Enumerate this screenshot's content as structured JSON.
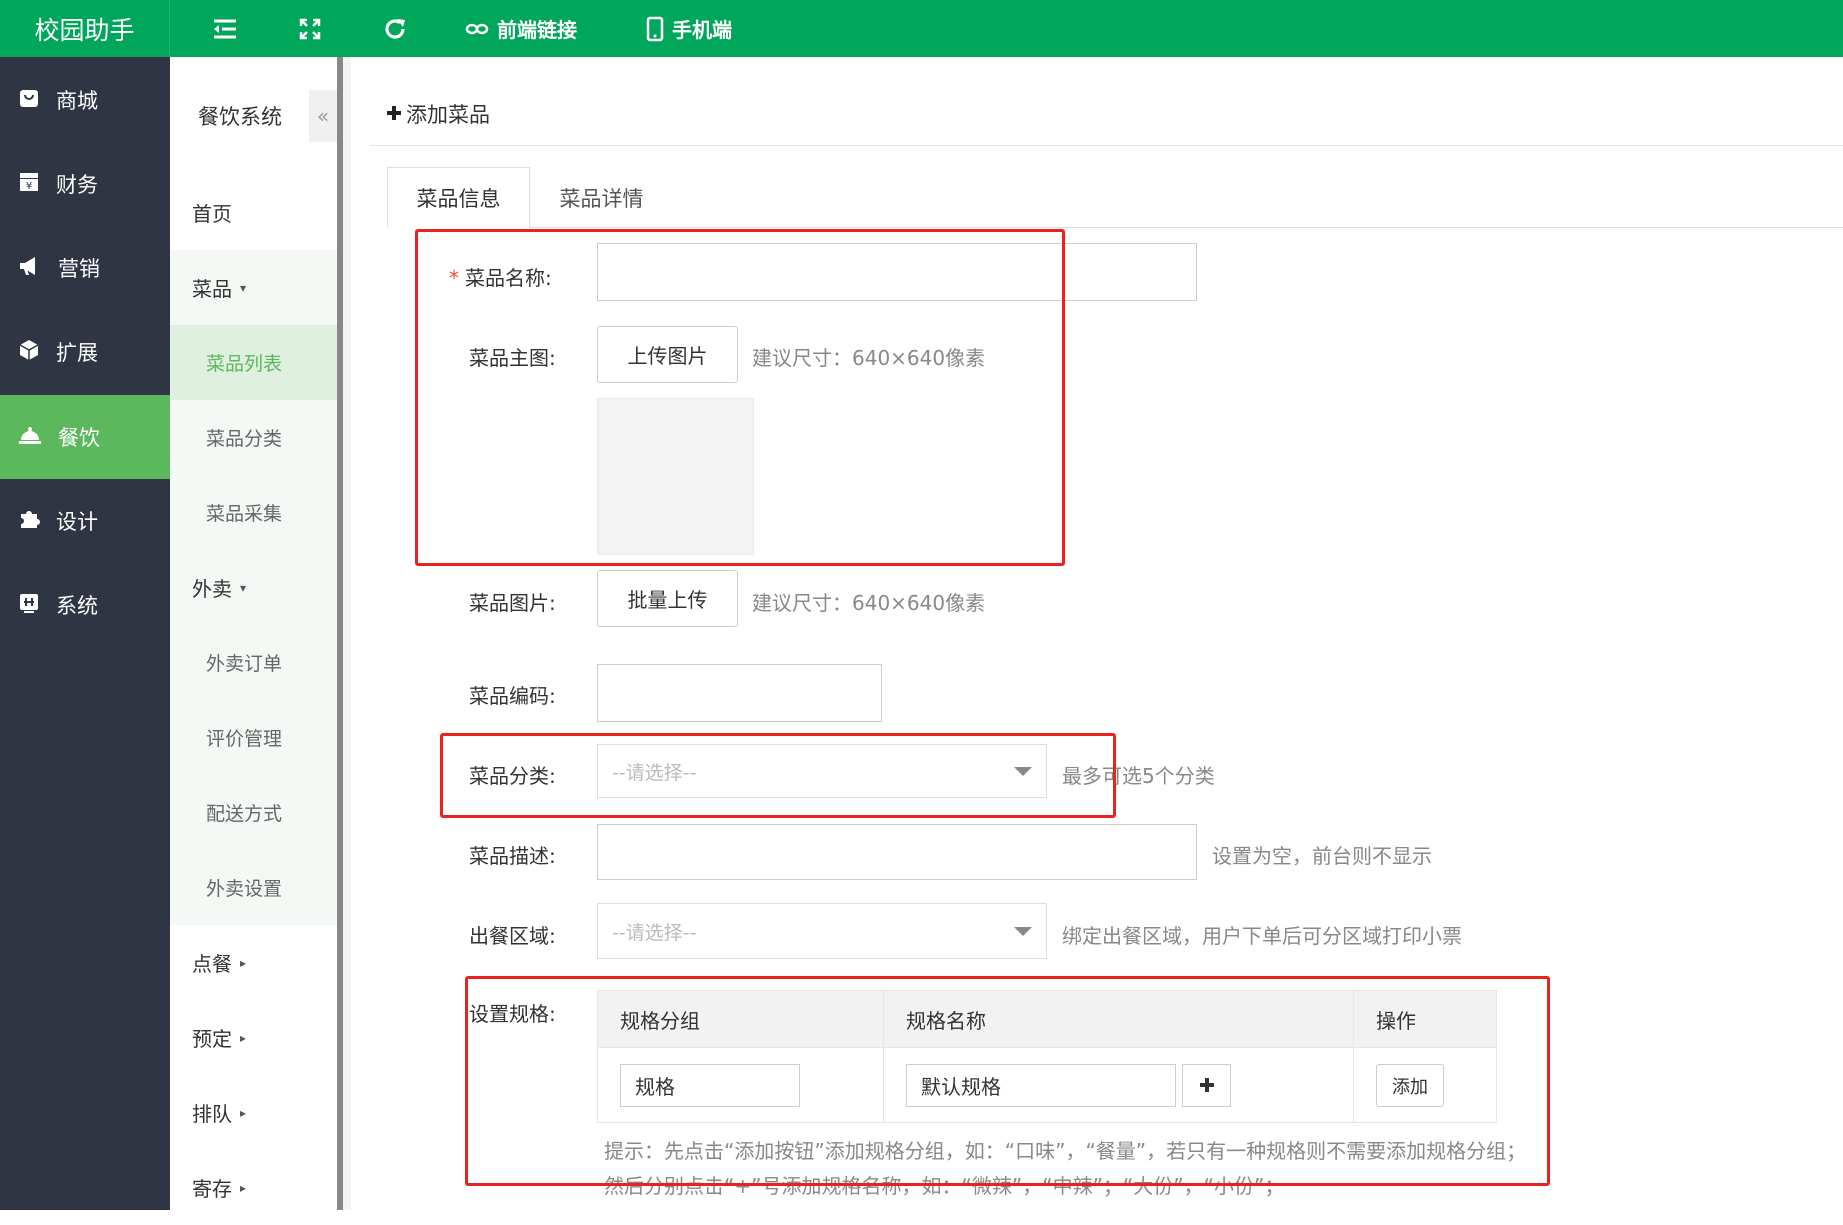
{
  "app": {
    "title": "校园助手"
  },
  "topbar": {
    "items": [
      {
        "icon": "menu-indent-icon",
        "label": ""
      },
      {
        "icon": "fullscreen-icon",
        "label": ""
      },
      {
        "icon": "refresh-icon",
        "label": ""
      },
      {
        "icon": "link-icon",
        "label": "前端链接"
      },
      {
        "icon": "mobile-icon",
        "label": "手机端"
      }
    ],
    "color": "#00a65a"
  },
  "leftnav": {
    "items": [
      {
        "icon": "shop-icon",
        "label": "商城"
      },
      {
        "icon": "finance-icon",
        "label": "财务"
      },
      {
        "icon": "megaphone-icon",
        "label": "营销"
      },
      {
        "icon": "cube-icon",
        "label": "扩展"
      },
      {
        "icon": "bell-dish-icon",
        "label": "餐饮",
        "active": true
      },
      {
        "icon": "puzzle-icon",
        "label": "设计"
      },
      {
        "icon": "system-icon",
        "label": "系统"
      }
    ],
    "active_color": "#5cb85c"
  },
  "subnav": {
    "title": "餐饮系统",
    "collapse": "«",
    "home": "首页",
    "groups": [
      {
        "label": "菜品",
        "caret": "▾",
        "children": [
          "菜品列表",
          "菜品分类",
          "菜品采集"
        ]
      },
      {
        "label": "外卖",
        "caret": "▾",
        "children": [
          "外卖订单",
          "评价管理",
          "配送方式",
          "外卖设置"
        ]
      },
      {
        "label": "点餐",
        "caret": "▸"
      },
      {
        "label": "预定",
        "caret": "▸"
      },
      {
        "label": "排队",
        "caret": "▸"
      },
      {
        "label": "寄存",
        "caret": "▸"
      }
    ],
    "active_child": "菜品列表"
  },
  "page": {
    "title": "添加菜品",
    "tabs": [
      "菜品信息",
      "菜品详情"
    ]
  },
  "form": {
    "name": {
      "label": "菜品名称:",
      "required": "*",
      "value": ""
    },
    "main_image": {
      "label": "菜品主图:",
      "button": "上传图片",
      "hint": "建议尺寸：640×640像素"
    },
    "images": {
      "label": "菜品图片:",
      "button": "批量上传",
      "hint": "建议尺寸：640×640像素"
    },
    "code": {
      "label": "菜品编码:",
      "value": ""
    },
    "category": {
      "label": "菜品分类:",
      "placeholder": "--请选择--",
      "hint": "最多可选5个分类"
    },
    "description": {
      "label": "菜品描述:",
      "value": "",
      "hint": "设置为空，前台则不显示"
    },
    "area": {
      "label": "出餐区域:",
      "placeholder": "--请选择--",
      "hint": "绑定出餐区域，用户下单后可分区域打印小票"
    },
    "spec": {
      "label": "设置规格:",
      "headers": [
        "规格分组",
        "规格名称",
        "操作"
      ],
      "row": {
        "group": "规格",
        "name": "默认规格",
        "plus": "+",
        "action": "添加"
      },
      "tip1": "提示：先点击“添加按钮”添加规格分组，如：“口味”，“餐量”，若只有一种规格则不需要添加规格分组；",
      "tip2": "然后分别点击“+”号添加规格名称，如：“微辣”，“中辣”；“大份”，“小份”；"
    }
  },
  "highlight_color": "#e8231f"
}
